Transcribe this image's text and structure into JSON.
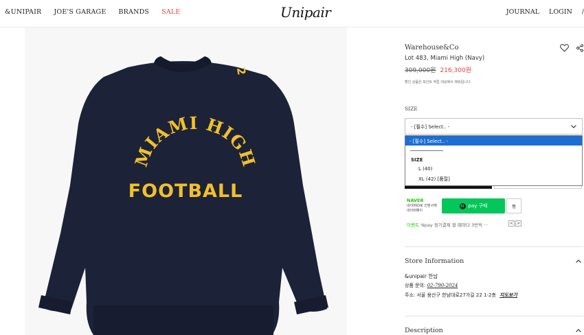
{
  "header": {
    "nav_left": [
      "&UNIPAIR",
      "JOE'S GARAGE",
      "BRANDS",
      "SALE"
    ],
    "logo": "Unipair",
    "nav_right": [
      "JOURNAL",
      "LOGIN",
      "/"
    ]
  },
  "product": {
    "brand": "Warehouse&Co",
    "name": "Lot 483, Miami High (Navy)",
    "price_original": "309,000원",
    "price_sale": "216,300원",
    "note": "할인 상품은 포인트 적립 대상에서 제외됩니다.",
    "image_text": [
      "MIAMI HIGH",
      "FOOTBALL",
      "2"
    ]
  },
  "size": {
    "label": "SIZE",
    "selected": "- [필수] Select.. -",
    "dropdown": {
      "highlighted": "- [필수] Select.. -",
      "separator": "-------------------",
      "group": "SIZE",
      "options": [
        "L (40)",
        "XL (42) [품절]"
      ]
    }
  },
  "naver": {
    "logo": "NAVER",
    "sub_line1": "네이버ID로 간편구매",
    "sub_line2": "네이버페이",
    "pay_button": "pay 구매",
    "pay_circle": "N",
    "wish_button": "찜",
    "event_label": "이벤트",
    "event_text": "Npay 정기결제 할 때마다 3번씩 ···",
    "pager_prev": "<",
    "pager_next": ">"
  },
  "store": {
    "title": "Store Information",
    "name": "&unipair 한남",
    "phone_label": "상품 문의:",
    "phone": "02-790-2024",
    "address_label": "주소:",
    "address": "서울 용산구 한남대로27가길 22 1-2층",
    "map_link": "지도보기"
  },
  "description": {
    "title": "Description"
  },
  "colors": {
    "accent_sale": "#e0443d",
    "select_highlight": "#1c6fd2",
    "npay_green": "#03c75a",
    "sweater_navy": "#1c2238",
    "print_yellow": "#f2c029"
  }
}
